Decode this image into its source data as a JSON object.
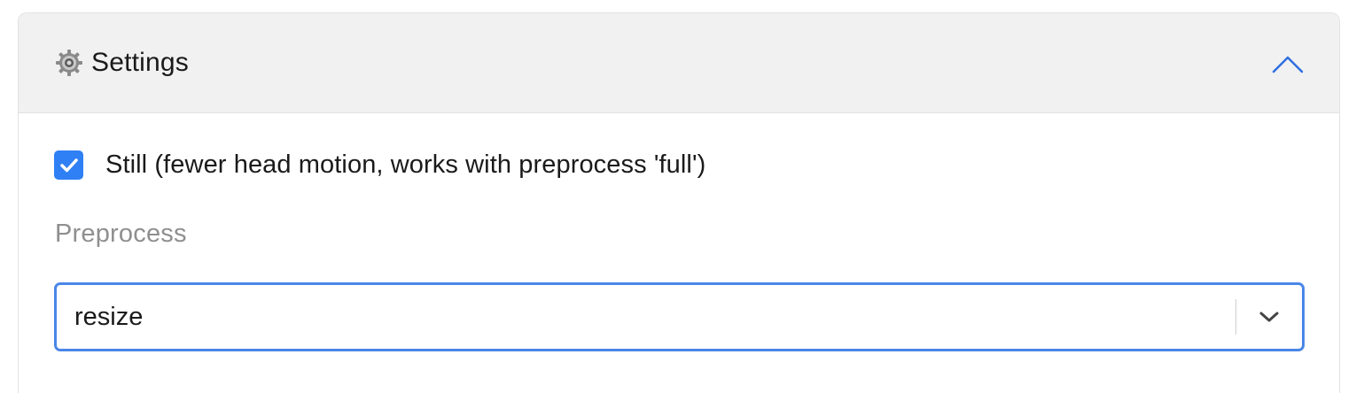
{
  "settings_panel": {
    "title": "Settings",
    "header_icon": "gear-icon",
    "collapse_icon": "chevron-up-icon",
    "expanded": true,
    "still": {
      "label": "Still (fewer head motion, works with preprocess 'full')",
      "checked": true
    },
    "preprocess": {
      "label": "Preprocess",
      "selected_value": "resize",
      "dropdown_icon": "chevron-down-icon"
    }
  },
  "colors": {
    "accent": "#2f80f5",
    "focus_border": "#4a86e8",
    "header_bg": "#f1f1f1",
    "muted_label": "#8f8f8f"
  }
}
